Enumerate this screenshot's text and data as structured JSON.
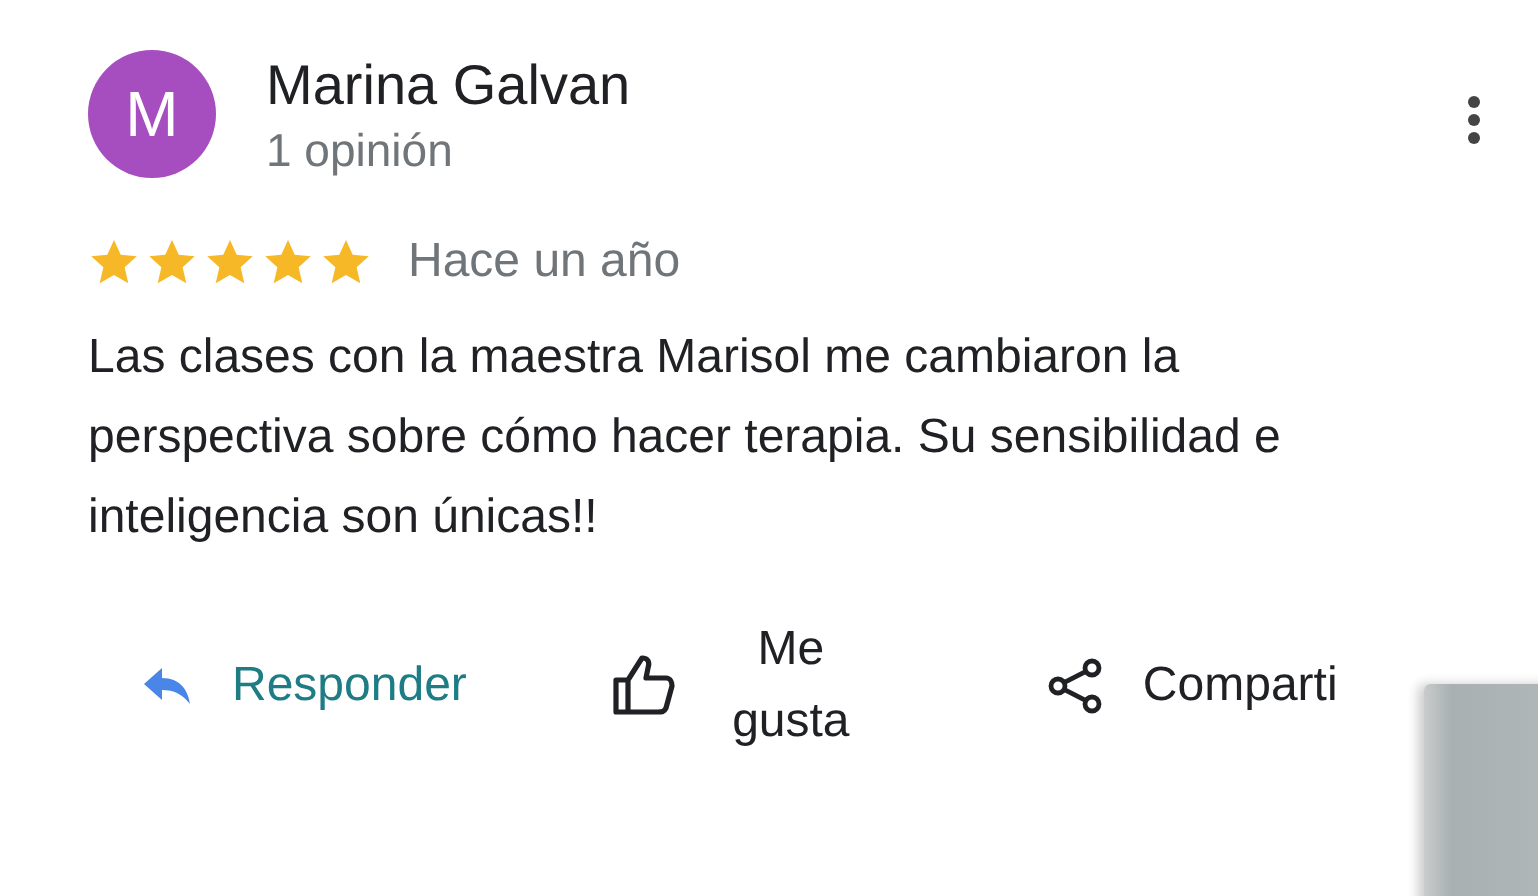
{
  "review": {
    "avatar_letter": "M",
    "name": "Marina Galvan",
    "subtitle": "1 opinión",
    "stars": 5,
    "time": "Hace un año",
    "text": "Las clases con la maestra Marisol me cambiaron la perspectiva sobre cómo hacer terapia. Su sensibilidad e inteligencia son únicas!!"
  },
  "actions": [
    {
      "kind": "reply",
      "label": "Responder"
    },
    {
      "kind": "like",
      "label": "Me gusta"
    },
    {
      "kind": "share",
      "label": "Comparti"
    }
  ]
}
